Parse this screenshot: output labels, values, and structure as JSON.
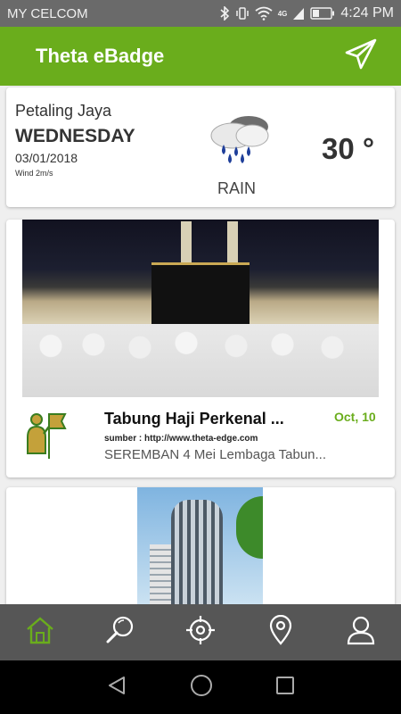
{
  "status_bar": {
    "carrier": "MY CELCOM",
    "network": "4G",
    "time": "4:24 PM"
  },
  "app_bar": {
    "title": "Theta eBadge",
    "action_icon": "send-icon"
  },
  "weather": {
    "city": "Petaling Jaya",
    "day": "WEDNESDAY",
    "date": "03/01/2018",
    "wind": "Wind 2m/s",
    "condition": "RAIN",
    "temperature": "30 °",
    "icon": "rain-cloud-icon"
  },
  "news": [
    {
      "title": "Tabung Haji Perkenal ...",
      "date": "Oct, 10",
      "source": "sumber : http://www.theta-edge.com",
      "snippet": "SEREMBAN 4 Mei Lembaga Tabun...",
      "icon": "guide-flag-icon"
    }
  ],
  "bottom_nav": {
    "items": [
      "home-icon",
      "search-icon",
      "target-icon",
      "location-pin-icon",
      "user-icon"
    ],
    "active_color": "#6aad1c",
    "inactive_color": "#ffffff"
  },
  "colors": {
    "accent": "#6aad1c",
    "status_bar": "#6a6a6a",
    "nav_bar": "#565656"
  }
}
